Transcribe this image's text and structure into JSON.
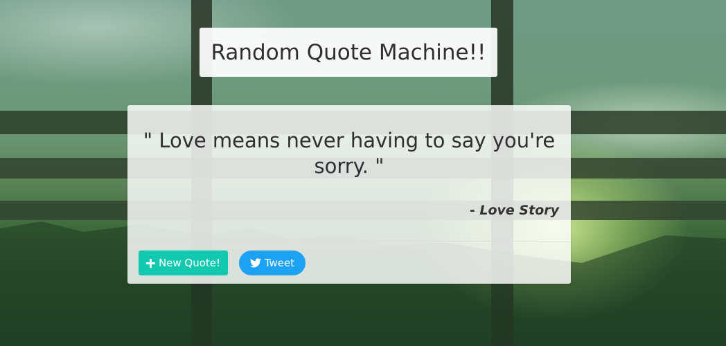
{
  "header": {
    "title": "Random Quote Machine!!"
  },
  "quote_card": {
    "quote_text": "\" Love means never having to say you're sorry. \"",
    "author_dash": "- ",
    "author_name": "Love Story"
  },
  "actions": {
    "new_quote_label": "New Quote!",
    "new_quote_icon": "plus-icon",
    "tweet_label": "Tweet",
    "tweet_icon": "twitter-bird-icon"
  },
  "colors": {
    "new_quote_button": "#12c9b0",
    "tweet_button": "#1da1f2"
  }
}
